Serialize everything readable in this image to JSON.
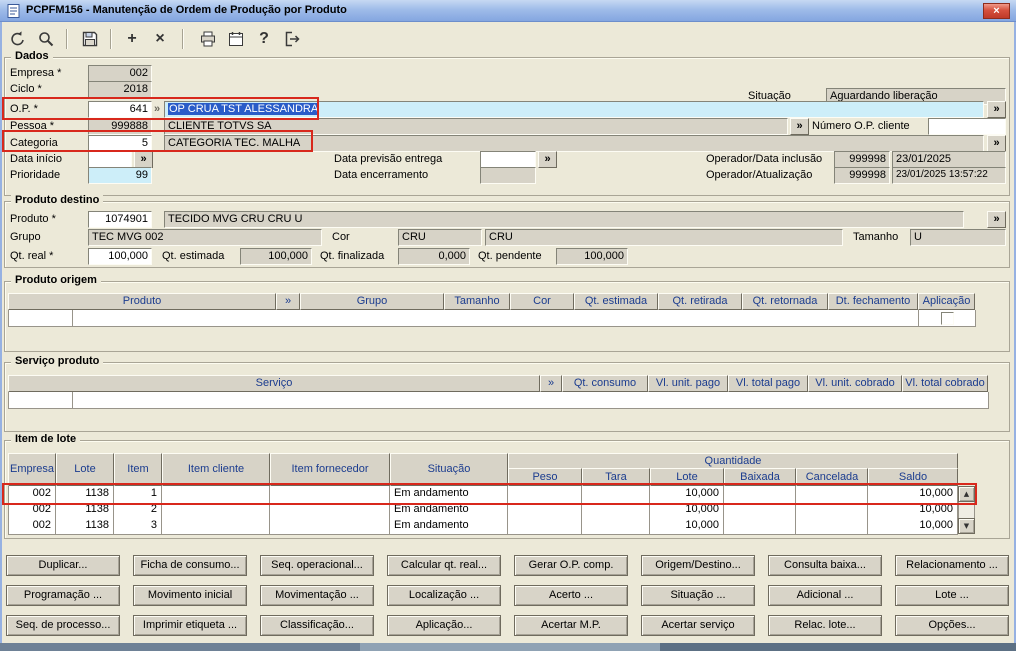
{
  "window": {
    "title": "PCPFM156 - Manutenção de Ordem de Produção por Produto"
  },
  "glyphs": {
    "zoom": "»",
    "up": "▲",
    "down": "▼",
    "plus": "+",
    "cross": "×",
    "help": "?",
    "close": "×"
  },
  "colors": {
    "selection": "#2a5cc8",
    "annotation": "#d8281c",
    "grid_header_text": "#1b3c8f",
    "titlebar": "#9fbce9",
    "field_disabled": "#d7d3c7",
    "field_highlight": "#cdeef9"
  },
  "toolbar": {
    "icons": [
      "undo",
      "search",
      "save",
      "add",
      "delete",
      "print",
      "calendar",
      "help",
      "exit"
    ]
  },
  "dados": {
    "legend": "Dados",
    "empresa_label": "Empresa *",
    "empresa": "002",
    "ciclo_label": "Ciclo *",
    "ciclo": "2018",
    "situacao_label": "Situação",
    "situacao": "Aguardando liberação",
    "op_label": "O.P. *",
    "op": "641",
    "op_desc": "OP CRUA TST ALESSANDRA",
    "pessoa_label": "Pessoa *",
    "pessoa": "999888",
    "pessoa_desc": "CLIENTE TOTVS SA",
    "numero_op_cliente_label": "Número O.P. cliente",
    "numero_op_cliente": "",
    "categoria_label": "Categoria",
    "categoria": "5",
    "categoria_desc": "CATEGORIA TEC. MALHA",
    "data_inicio_label": "Data início",
    "data_inicio": "",
    "data_previsao_label": "Data previsão entrega",
    "data_previsao": "",
    "data_encerramento_label": "Data encerramento",
    "data_encerramento": "",
    "prioridade_label": "Prioridade",
    "prioridade": "99",
    "operador_inclusao_label": "Operador/Data inclusão",
    "operador_inclusao": "999998",
    "data_inclusao": "23/01/2025",
    "operador_atualizacao_label": "Operador/Atualização",
    "operador_atualizacao": "999998",
    "data_atualizacao": "23/01/2025 13:57:22"
  },
  "produto_destino": {
    "legend": "Produto destino",
    "produto_label": "Produto *",
    "produto": "1074901",
    "produto_desc": "TECIDO MVG CRU CRU U",
    "grupo_label": "Grupo",
    "grupo": "TEC MVG 002",
    "cor_label": "Cor",
    "cor": "CRU",
    "cor_desc": "CRU",
    "tamanho_label": "Tamanho",
    "tamanho": "U",
    "qt_real_label": "Qt. real *",
    "qt_real": "100,000",
    "qt_estimada_label": "Qt. estimada",
    "qt_estimada": "100,000",
    "qt_finalizada_label": "Qt. finalizada",
    "qt_finalizada": "0,000",
    "qt_pendente_label": "Qt. pendente",
    "qt_pendente": "100,000"
  },
  "produto_origem": {
    "legend": "Produto origem",
    "headers": [
      "Produto",
      "»",
      "Grupo",
      "Tamanho",
      "Cor",
      "Qt. estimada",
      "Qt. retirada",
      "Qt. retornada",
      "Dt. fechamento",
      "Aplicação"
    ]
  },
  "servico_produto": {
    "legend": "Serviço produto",
    "headers": [
      "Serviço",
      "»",
      "Qt. consumo",
      "Vl. unit. pago",
      "Vl. total pago",
      "Vl. unit. cobrado",
      "Vl. total cobrado"
    ]
  },
  "item_lote": {
    "legend": "Item de lote",
    "headers": {
      "empresa": "Empresa",
      "lote": "Lote",
      "item": "Item",
      "item_cliente": "Item cliente",
      "item_fornecedor": "Item fornecedor",
      "situacao": "Situação",
      "quantidade": "Quantidade",
      "peso": "Peso",
      "tara": "Tara",
      "lote_qt": "Lote",
      "baixada": "Baixada",
      "cancelada": "Cancelada",
      "saldo": "Saldo"
    },
    "rows": [
      {
        "empresa": "002",
        "lote": "1138",
        "item": "1",
        "item_cliente": "",
        "item_fornecedor": "",
        "situacao": "Em andamento",
        "peso": "",
        "tara": "",
        "lote_qt": "10,000",
        "baixada": "",
        "cancelada": "",
        "saldo": "10,000"
      },
      {
        "empresa": "002",
        "lote": "1138",
        "item": "2",
        "item_cliente": "",
        "item_fornecedor": "",
        "situacao": "Em andamento",
        "peso": "",
        "tara": "",
        "lote_qt": "10,000",
        "baixada": "",
        "cancelada": "",
        "saldo": "10,000"
      },
      {
        "empresa": "002",
        "lote": "1138",
        "item": "3",
        "item_cliente": "",
        "item_fornecedor": "",
        "situacao": "Em andamento",
        "peso": "",
        "tara": "",
        "lote_qt": "10,000",
        "baixada": "",
        "cancelada": "",
        "saldo": "10,000"
      }
    ]
  },
  "actions": [
    "Duplicar...",
    "Ficha de consumo...",
    "Seq. operacional...",
    "Calcular qt. real...",
    "Gerar O.P. comp.",
    "Origem/Destino...",
    "Consulta baixa...",
    "Relacionamento ...",
    "Programação ...",
    "Movimento inicial",
    "Movimentação ...",
    "Localização ...",
    "Acerto ...",
    "Situação ...",
    "Adicional ...",
    "Lote ...",
    "Seq. de processo...",
    "Imprimir etiqueta ...",
    "Classificação...",
    "Aplicação...",
    "Acertar M.P.",
    "Acertar serviço",
    "Relac. lote...",
    "Opções..."
  ]
}
